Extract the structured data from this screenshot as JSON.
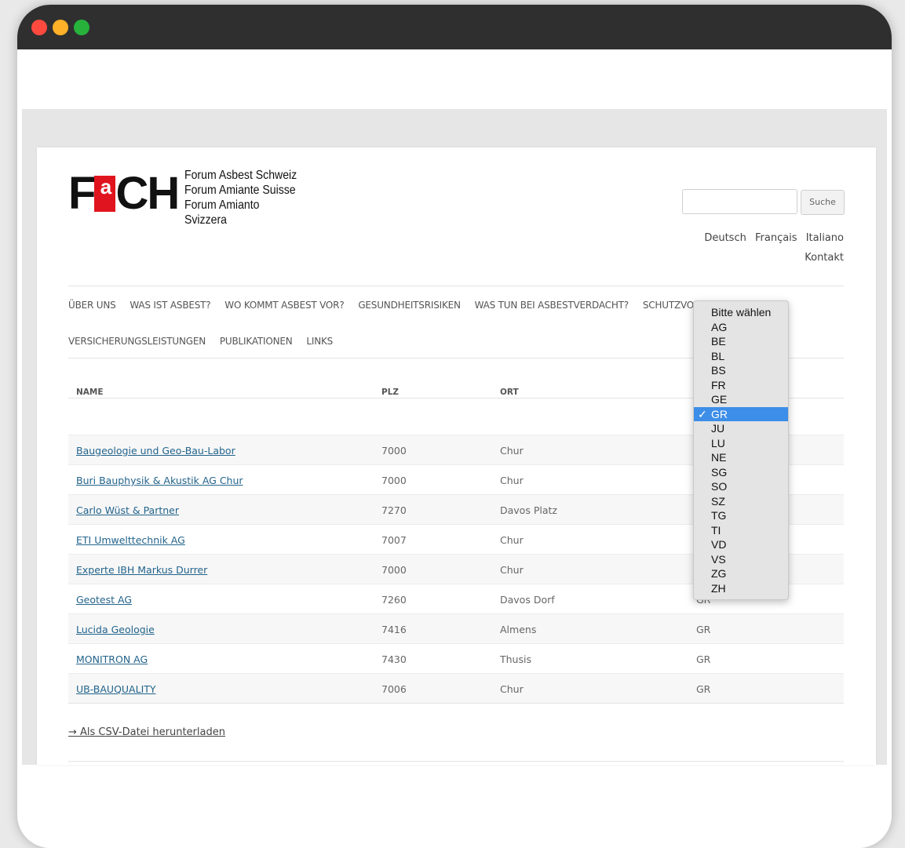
{
  "logo": {
    "lines": [
      "Forum Asbest Schweiz",
      "Forum Amiante Suisse",
      "Forum Amianto Svizzera"
    ]
  },
  "search": {
    "button_label": "Suche"
  },
  "languages": [
    "Deutsch",
    "Français",
    "Italiano"
  ],
  "contact_label": "Kontakt",
  "nav": {
    "row1": [
      "ÜBER UNS",
      "WAS IST ASBEST?",
      "WO KOMMT ASBEST VOR?",
      "GESUNDHEITSRISIKEN",
      "WAS TUN BEI ASBESTVERDACHT?",
      "SCHUTZVORSCH"
    ],
    "row2": [
      "VERSICHERUNGSLEISTUNGEN",
      "PUBLIKATIONEN",
      "LINKS"
    ]
  },
  "table": {
    "headers": [
      "NAME",
      "PLZ",
      "ORT"
    ],
    "rows": [
      {
        "name": "Baugeologie und Geo-Bau-Labor",
        "plz": "7000",
        "ort": "Chur",
        "kanton": ""
      },
      {
        "name": "Buri Bauphysik & Akustik AG Chur",
        "plz": "7000",
        "ort": "Chur",
        "kanton": ""
      },
      {
        "name": "Carlo Wüst & Partner",
        "plz": "7270",
        "ort": "Davos Platz",
        "kanton": ""
      },
      {
        "name": "ETI Umwelttechnik AG",
        "plz": "7007",
        "ort": "Chur",
        "kanton": ""
      },
      {
        "name": "Experte IBH Markus Durrer",
        "plz": "7000",
        "ort": "Chur",
        "kanton": ""
      },
      {
        "name": "Geotest AG",
        "plz": "7260",
        "ort": "Davos Dorf",
        "kanton": "GR"
      },
      {
        "name": "Lucida Geologie",
        "plz": "7416",
        "ort": "Almens",
        "kanton": "GR"
      },
      {
        "name": "MONITRON AG",
        "plz": "7430",
        "ort": "Thusis",
        "kanton": "GR"
      },
      {
        "name": "UB-BAUQUALITY",
        "plz": "7006",
        "ort": "Chur",
        "kanton": "GR"
      }
    ]
  },
  "csv_link": "→ Als CSV-Datei herunterladen",
  "canton_dropdown": {
    "options": [
      "Bitte wählen",
      "AG",
      "BE",
      "BL",
      "BS",
      "FR",
      "GE",
      "GR",
      "JU",
      "LU",
      "NE",
      "SG",
      "SO",
      "SZ",
      "TG",
      "TI",
      "VD",
      "VS",
      "ZG",
      "ZH"
    ],
    "selected": "GR",
    "check_mark": "✓"
  }
}
